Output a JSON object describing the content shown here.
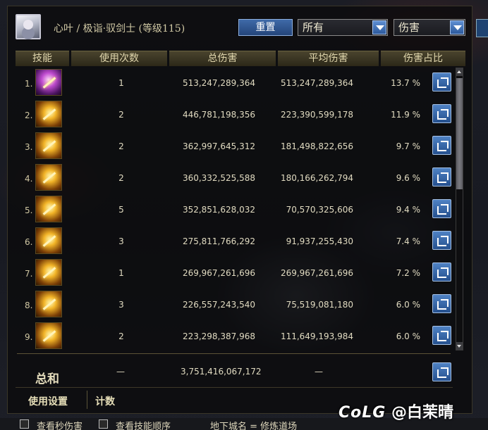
{
  "header": {
    "character": "心叶 / 极诣·驭剑士 (等级115)",
    "reset_label": "重置",
    "filter_select": "所有",
    "type_select": "伤害"
  },
  "table": {
    "columns": [
      "技能",
      "使用次数",
      "总伤害",
      "平均伤害",
      "伤害占比"
    ],
    "rows": [
      {
        "index": "1.",
        "uses": "1",
        "total": "513,247,289,364",
        "avg": "513,247,289,364",
        "pct": "13.7 %"
      },
      {
        "index": "2.",
        "uses": "2",
        "total": "446,781,198,356",
        "avg": "223,390,599,178",
        "pct": "11.9 %"
      },
      {
        "index": "3.",
        "uses": "2",
        "total": "362,997,645,312",
        "avg": "181,498,822,656",
        "pct": "9.7 %"
      },
      {
        "index": "4.",
        "uses": "2",
        "total": "360,332,525,588",
        "avg": "180,166,262,794",
        "pct": "9.6 %"
      },
      {
        "index": "5.",
        "uses": "5",
        "total": "352,851,628,032",
        "avg": "70,570,325,606",
        "pct": "9.4 %"
      },
      {
        "index": "6.",
        "uses": "3",
        "total": "275,811,766,292",
        "avg": "91,937,255,430",
        "pct": "7.4 %"
      },
      {
        "index": "7.",
        "uses": "1",
        "total": "269,967,261,696",
        "avg": "269,967,261,696",
        "pct": "7.2 %"
      },
      {
        "index": "8.",
        "uses": "3",
        "total": "226,557,243,540",
        "avg": "75,519,081,180",
        "pct": "6.0 %"
      },
      {
        "index": "9.",
        "uses": "2",
        "total": "223,298,387,968",
        "avg": "111,649,193,984",
        "pct": "6.0 %"
      }
    ]
  },
  "summary": {
    "label": "总和",
    "uses": "—",
    "total": "3,751,416,067,172",
    "avg": "—"
  },
  "tabs": {
    "settings": "使用设置",
    "count": "计数"
  },
  "bottom": {
    "cb1_label": "查看秒伤害",
    "cb2_label": "查看技能顺序",
    "dungeon": "地下城名 = 修炼道场"
  },
  "watermark": {
    "logo": "CoLG",
    "handle": "@白茉晴"
  },
  "colors": {
    "accent_blue": "#2d5a9c",
    "header_gold": "#4a442e"
  }
}
